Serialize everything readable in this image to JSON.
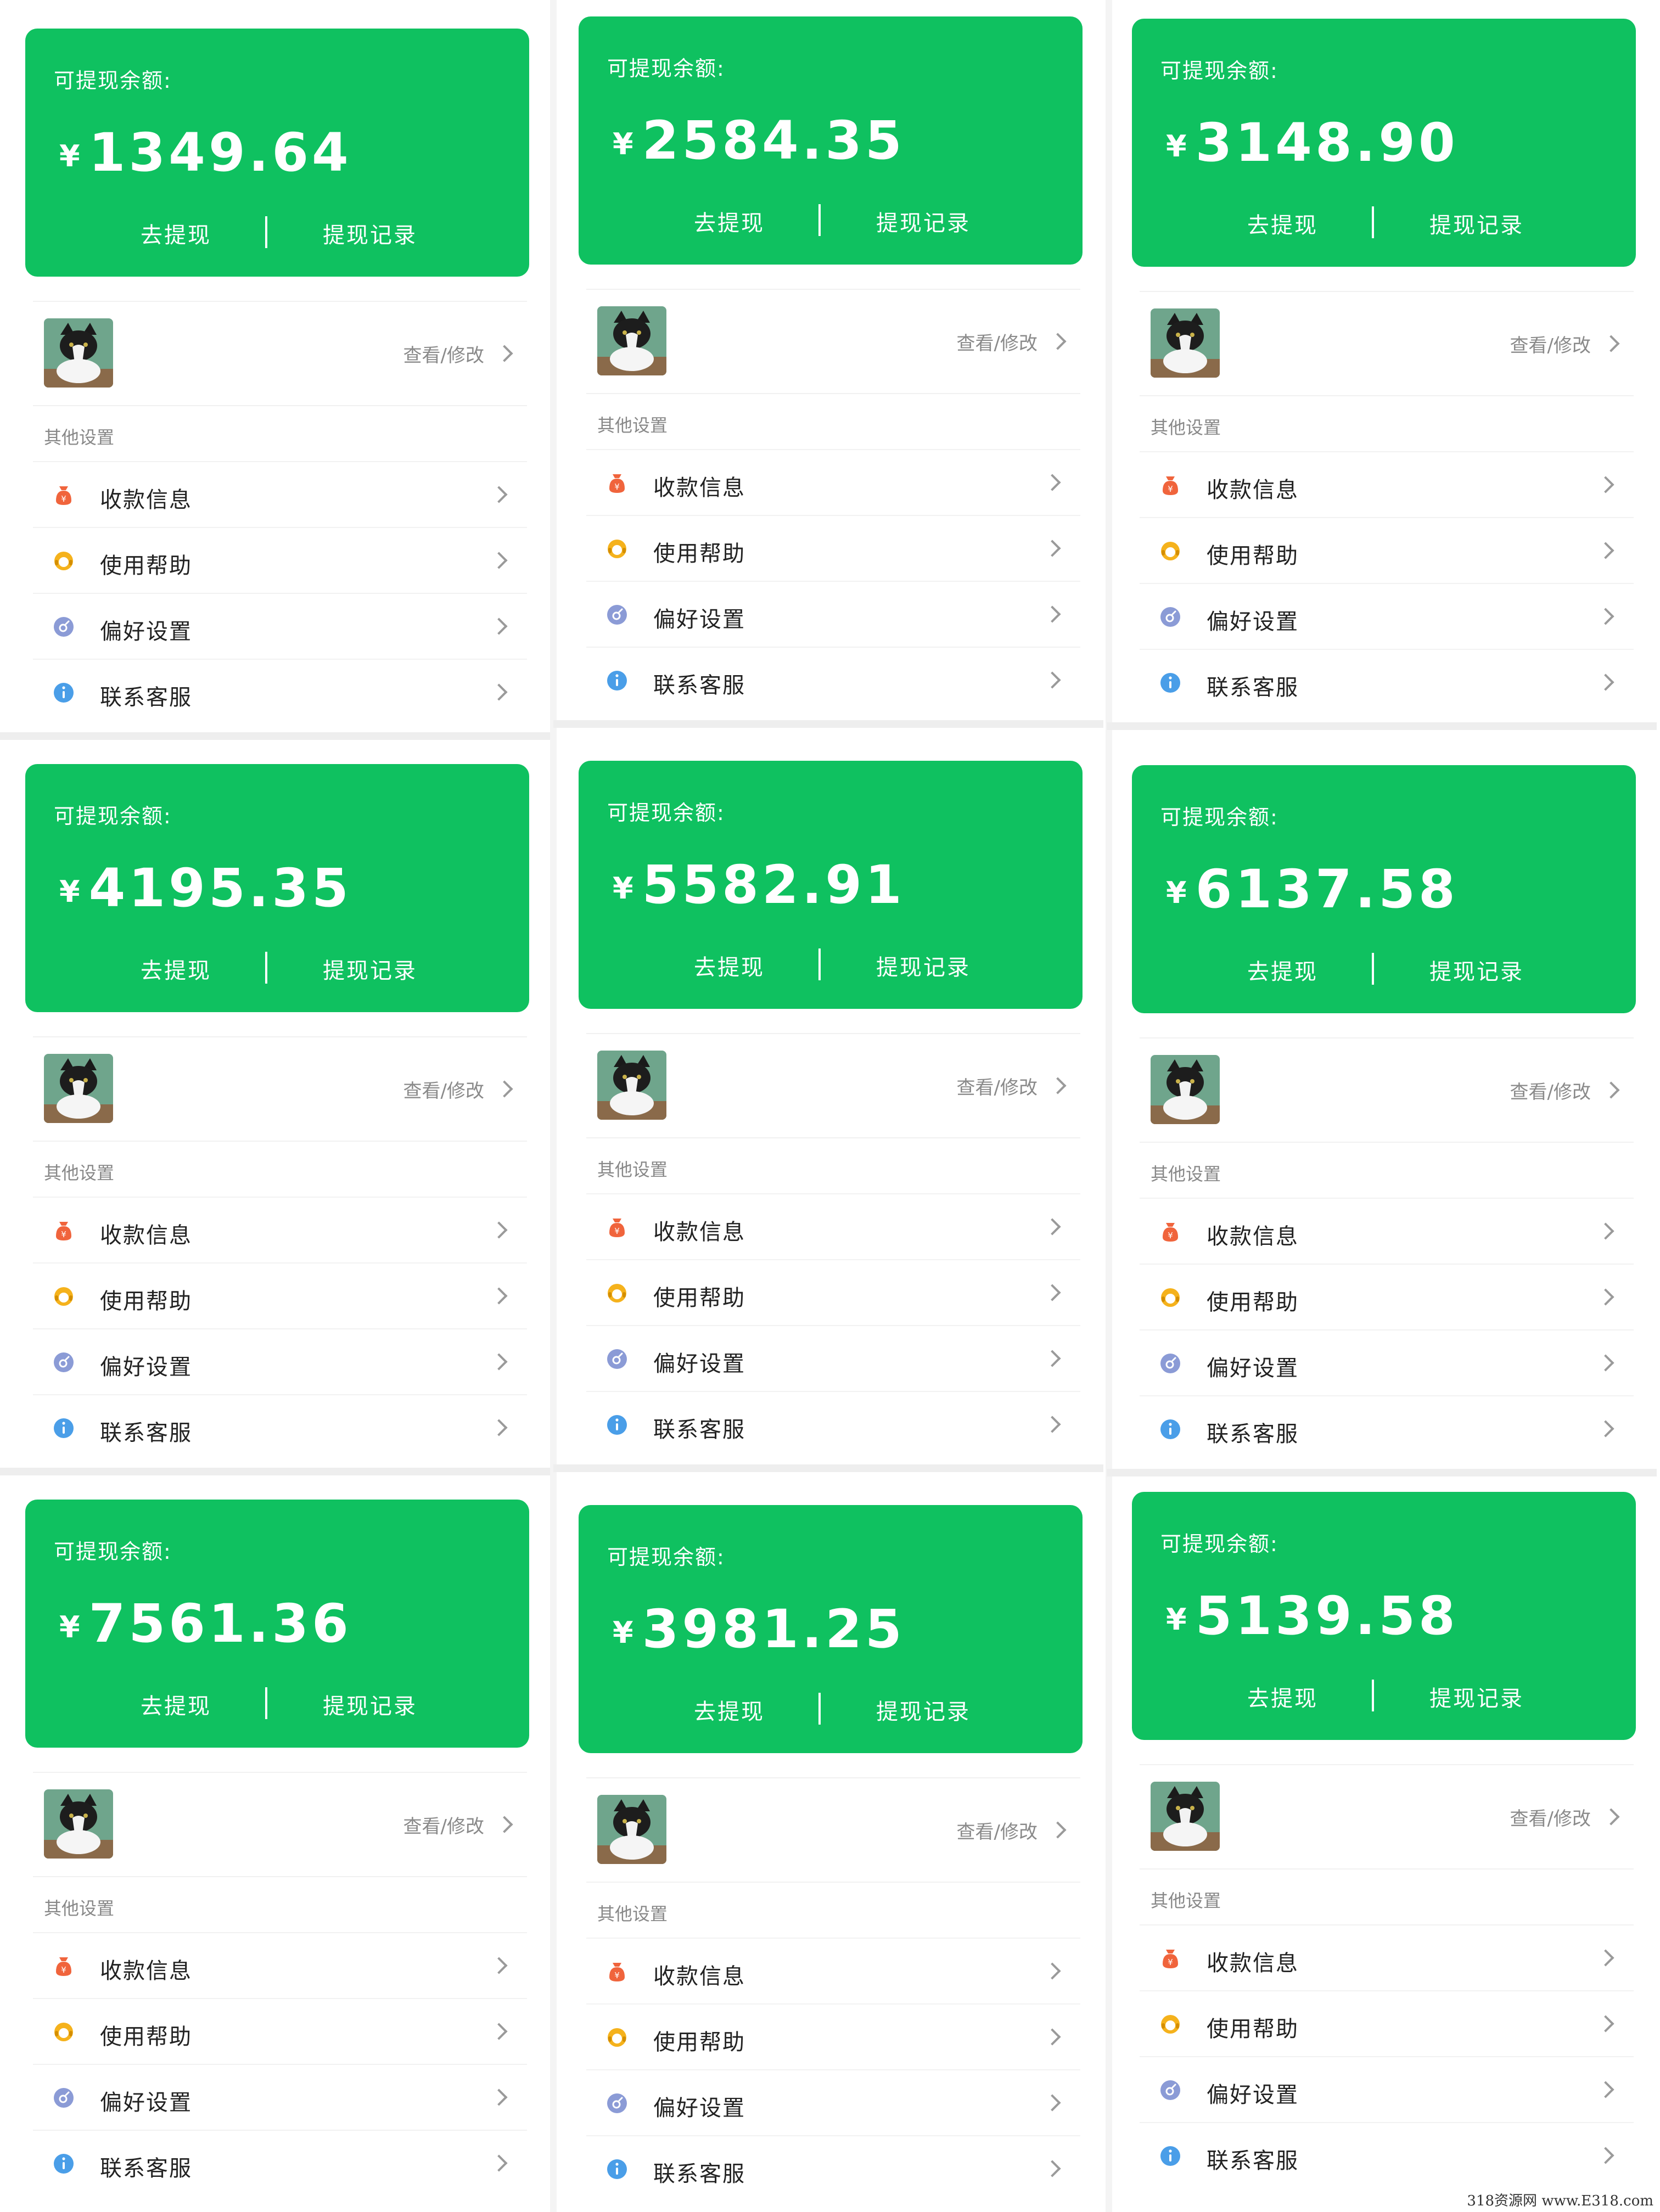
{
  "card": {
    "balance_label": "可提现余额:",
    "currency": "¥",
    "withdraw_label": "去提现",
    "records_label": "提现记录"
  },
  "profile": {
    "view_edit_label": "查看/修改"
  },
  "settings": {
    "section_title": "其他设置",
    "items": [
      {
        "label": "收款信息",
        "icon": "money-bag-icon",
        "color": "#f0643c"
      },
      {
        "label": "使用帮助",
        "icon": "help-headset-icon",
        "color": "#f5b21c"
      },
      {
        "label": "偏好设置",
        "icon": "preferences-icon",
        "color": "#8b9bd6"
      },
      {
        "label": "联系客服",
        "icon": "info-icon",
        "color": "#4a9ee8"
      }
    ]
  },
  "panels": [
    {
      "amount": "1349.64"
    },
    {
      "amount": "2584.35"
    },
    {
      "amount": "3148.90"
    },
    {
      "amount": "4195.35"
    },
    {
      "amount": "5582.91"
    },
    {
      "amount": "6137.58"
    },
    {
      "amount": "7561.36"
    },
    {
      "amount": "3981.25"
    },
    {
      "amount": "5139.58"
    }
  ],
  "colors": {
    "card_green": "#0fc160"
  },
  "watermark": "318资源网 www.E318.com"
}
